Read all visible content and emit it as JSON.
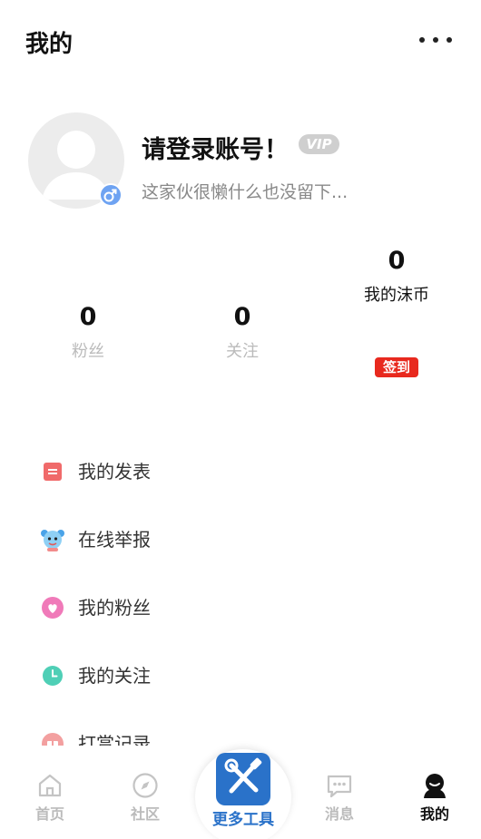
{
  "header": {
    "title": "我的",
    "more_icon": "more-dots-icon"
  },
  "profile": {
    "avatar_icon": "default-avatar-icon",
    "gender_icon": "male-icon",
    "username": "请登录账号！",
    "vip_label": "VIP",
    "bio": "这家伙很懒什么也没留下..."
  },
  "stats": {
    "fans": {
      "value": "0",
      "label": "粉丝"
    },
    "follow": {
      "value": "0",
      "label": "关注"
    },
    "coins": {
      "value": "0",
      "label": "我的沫币"
    },
    "checkin_label": "签到"
  },
  "menu": {
    "items": [
      {
        "label": "我的发表",
        "icon": "post-icon"
      },
      {
        "label": "在线举报",
        "icon": "report-mascot-icon"
      },
      {
        "label": "我的粉丝",
        "icon": "heart-icon"
      },
      {
        "label": "我的关注",
        "icon": "clock-icon"
      },
      {
        "label": "打赏记录",
        "icon": "gift-icon"
      }
    ]
  },
  "tabbar": {
    "tabs": [
      {
        "label": "首页",
        "icon": "home-icon"
      },
      {
        "label": "社区",
        "icon": "compass-icon"
      },
      {
        "label": "更多工具",
        "icon": "tools-icon"
      },
      {
        "label": "消息",
        "icon": "message-icon"
      },
      {
        "label": "我的",
        "icon": "user-icon"
      }
    ]
  },
  "colors": {
    "accent": "#2a72c9",
    "checkin": "#e8291e",
    "muted": "#bbbbbb"
  }
}
